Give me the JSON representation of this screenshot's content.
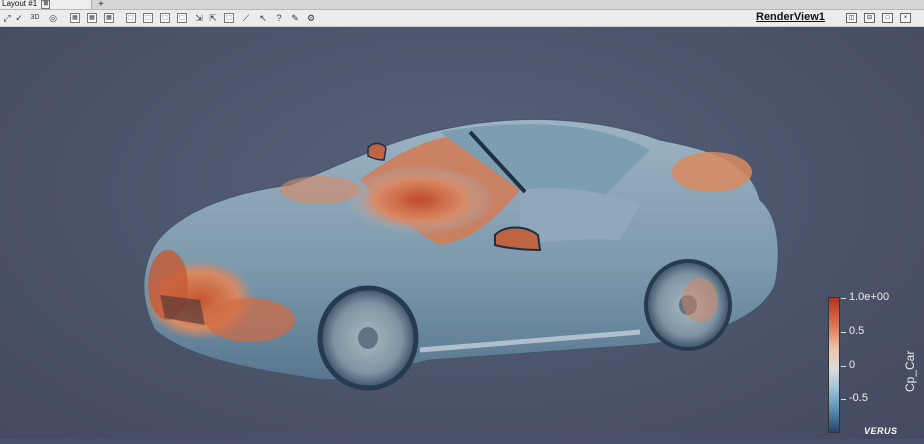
{
  "tab": {
    "label": "Layout #1",
    "close_glyph": "⊠",
    "add_glyph": "+"
  },
  "toolbar": {
    "icons": [
      "reset-camera-icon",
      "3d-toggle-icon",
      "select-cells-icon",
      "select-points-icon",
      "frustum-icon",
      "interactive-select-icon",
      "select-block-icon",
      "hover-points-icon",
      "hover-cells-icon",
      "select-surface-icon",
      "pick-center-icon",
      "zoom-box-icon",
      "ruler-icon",
      "help-icon",
      "settings-icon"
    ],
    "three_d_label": "3D"
  },
  "render_view": {
    "label": "RenderView1"
  },
  "colorbar": {
    "title": "Cp_Car",
    "ticks": [
      "1.0e+00",
      "0.5",
      "0",
      "-0.5"
    ],
    "colors": {
      "high": "#b4321f",
      "mid": "#dcdcdc",
      "low": "#23466b"
    }
  },
  "logo": {
    "text": "VERUS"
  }
}
